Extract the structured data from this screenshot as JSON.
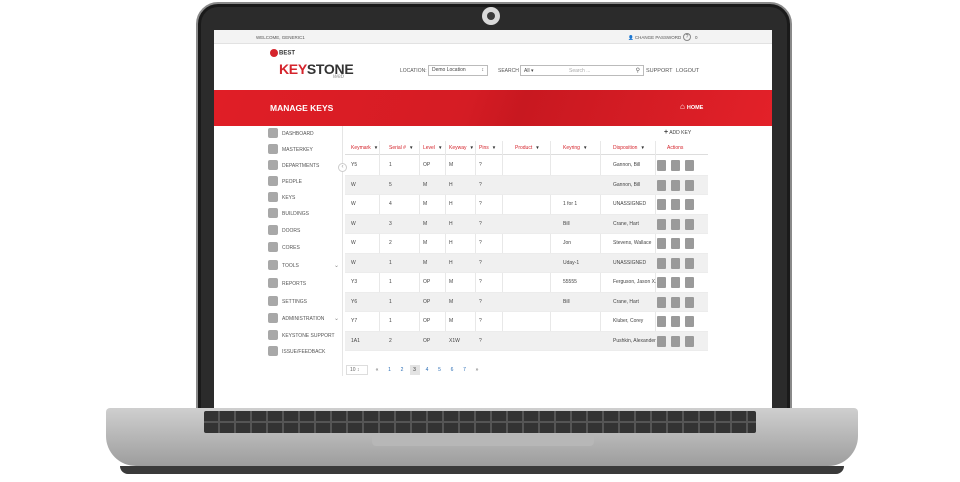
{
  "topbar": {
    "welcome": "WELCOME, GENERIC1",
    "change_password": "CHANGE PASSWORD",
    "help": "?",
    "count": "0"
  },
  "logo": {
    "brand": "BEST",
    "product_red": "KEY",
    "product_dark": "STONE",
    "sub": "web"
  },
  "header": {
    "location_label": "LOCATION:",
    "location_value": "Demo Location",
    "search_label": "SEARCH",
    "search_scope": "All",
    "search_placeholder": "Search ...",
    "support": "SUPPORT",
    "logout": "LOGOUT"
  },
  "banner": {
    "title": "MANAGE KEYS",
    "home": "HOME"
  },
  "sidebar": {
    "items": [
      {
        "label": "DASHBOARD"
      },
      {
        "label": "MASTERKEY"
      },
      {
        "label": "DEPARTMENTS"
      },
      {
        "label": "PEOPLE"
      },
      {
        "label": "KEYS"
      },
      {
        "label": "BUILDINGS"
      },
      {
        "label": "DOORS"
      },
      {
        "label": "CORES"
      },
      {
        "label": "TOOLS",
        "expandable": true
      },
      {
        "label": "REPORTS"
      },
      {
        "label": "SETTINGS"
      },
      {
        "label": "ADMINISTRATION",
        "expandable": true
      },
      {
        "label": "KEYSTONE SUPPORT"
      },
      {
        "label": "ISSUE/FEEDBACK"
      }
    ]
  },
  "add_key": "ADD KEY",
  "table": {
    "columns": [
      "Keymark",
      "Serial #",
      "Level",
      "Keyway",
      "Pins",
      "Product",
      "Keyring",
      "Disposition",
      "Actions"
    ],
    "rows": [
      [
        "Y5",
        "1",
        "OP",
        "M",
        "?",
        "",
        "",
        "Gannon, Bill"
      ],
      [
        "W",
        "5",
        "M",
        "H",
        "?",
        "",
        "",
        "Gannon, Bill"
      ],
      [
        "W",
        "4",
        "M",
        "H",
        "?",
        "",
        "1 for 1",
        "UNASSIGNED"
      ],
      [
        "W",
        "3",
        "M",
        "H",
        "?",
        "",
        "Bill",
        "Crane, Hart"
      ],
      [
        "W",
        "2",
        "M",
        "H",
        "?",
        "",
        "Jon",
        "Stevens, Wallace"
      ],
      [
        "W",
        "1",
        "M",
        "H",
        "?",
        "",
        "Uday-1",
        "UNASSIGNED"
      ],
      [
        "Y3",
        "1",
        "OP",
        "M",
        "?",
        "",
        "55555",
        "Ferguson, Jason X."
      ],
      [
        "Y6",
        "1",
        "OP",
        "M",
        "?",
        "",
        "Bill",
        "Crane, Hart"
      ],
      [
        "Y7",
        "1",
        "OP",
        "M",
        "?",
        "",
        "",
        "Kluber, Corey"
      ],
      [
        "1A1",
        "2",
        "OP",
        "X1W",
        "?",
        "",
        "",
        "Pushkin, Alexander"
      ]
    ]
  },
  "pagination": {
    "page_size": "10",
    "pages": [
      "1",
      "2",
      "3",
      "4",
      "5",
      "6",
      "7"
    ],
    "current": "3",
    "prev": "«",
    "next": "»"
  }
}
